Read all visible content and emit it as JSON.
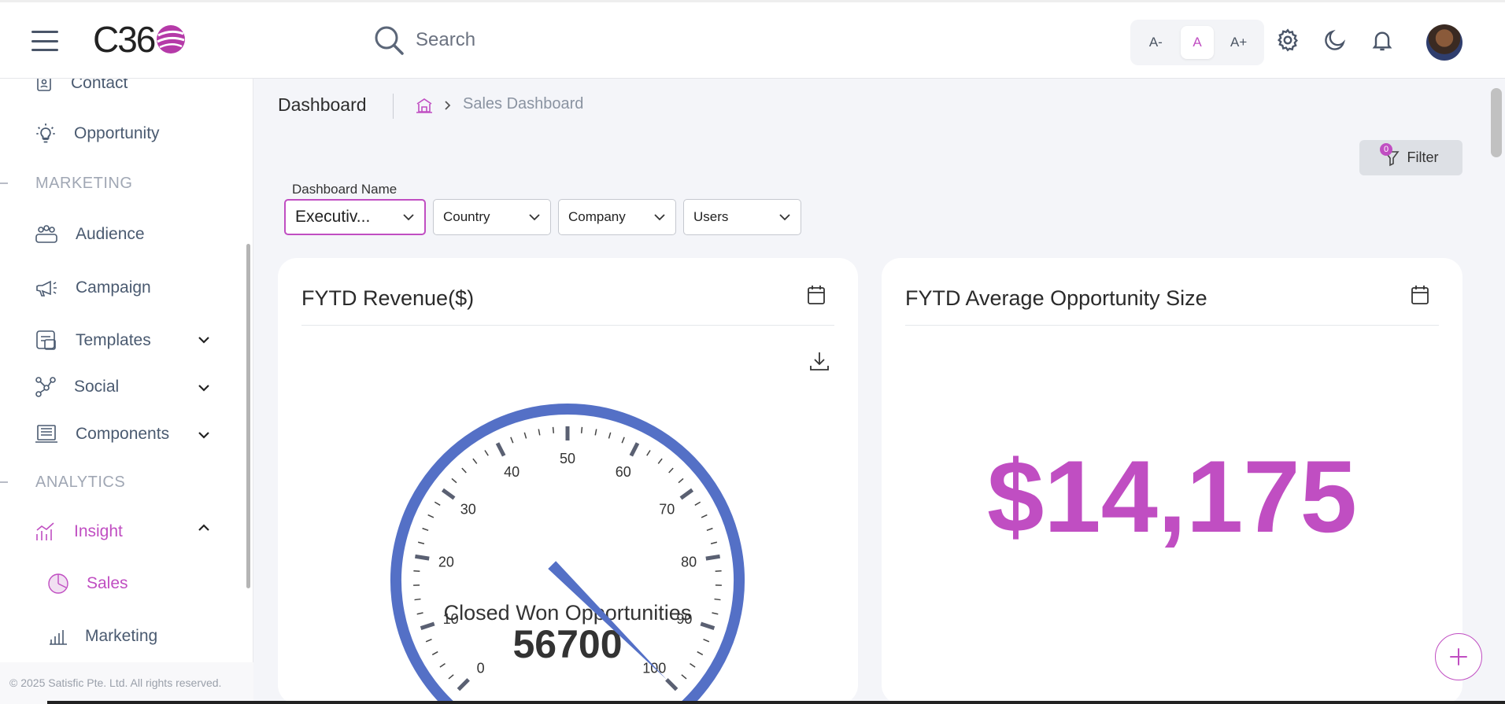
{
  "header": {
    "logo_text": "C36",
    "search_placeholder": "Search",
    "font_sizes": [
      "A-",
      "A",
      "A+"
    ]
  },
  "sidebar": {
    "items": [
      {
        "label": "Contact",
        "icon": "contact-icon"
      },
      {
        "label": "Opportunity",
        "icon": "lightbulb-icon"
      },
      {
        "section": "MARKETING"
      },
      {
        "label": "Audience",
        "icon": "audience-icon"
      },
      {
        "label": "Campaign",
        "icon": "megaphone-icon"
      },
      {
        "label": "Templates",
        "icon": "templates-icon"
      },
      {
        "label": "Social",
        "icon": "social-icon"
      },
      {
        "label": "Components",
        "icon": "components-icon"
      },
      {
        "section": "ANALYTICS"
      },
      {
        "label": "Insight",
        "icon": "insight-icon"
      },
      {
        "label": "Sales",
        "icon": "pie-chart-icon"
      },
      {
        "label": "Marketing",
        "icon": "bar-chart-icon"
      }
    ],
    "copyright": "© 2025 Satisfic Pte. Ltd. All rights reserved."
  },
  "breadcrumb": {
    "title": "Dashboard",
    "current": "Sales Dashboard"
  },
  "filter": {
    "label": "Filter",
    "count": "0"
  },
  "filters": {
    "dashboard_name_label": "Dashboard Name",
    "dashboard_name_value": "Executiv...",
    "country": "Country",
    "company": "Company",
    "users": "Users"
  },
  "cards": {
    "revenue": {
      "title": "FYTD Revenue($)",
      "gauge_label": "Closed Won Opportunities",
      "gauge_value": "56700"
    },
    "avg_opportunity": {
      "title": "FYTD Average Opportunity Size",
      "value": "$14,175"
    }
  },
  "gauge": {
    "min": 0,
    "max": 100,
    "tick_labels": [
      "0",
      "10",
      "20",
      "30",
      "40",
      "50",
      "60",
      "70",
      "80",
      "90",
      "100"
    ],
    "needle_value": 100,
    "arc_color": "#5470c6"
  },
  "colors": {
    "accent": "#c04ec2",
    "text": "#4a5a70"
  }
}
